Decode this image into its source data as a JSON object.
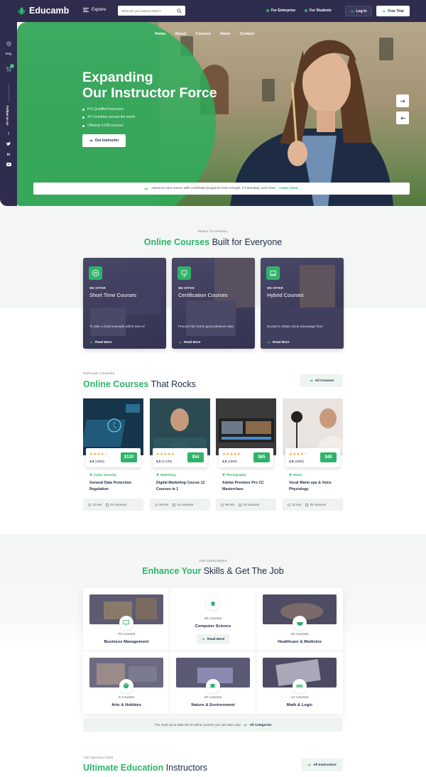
{
  "header": {
    "brand": "Educamb",
    "explore_label": "Explore",
    "search_placeholder": "What do you want to learn?",
    "for_enterprise": "For Enterprise",
    "for_students": "For Students",
    "login_label": "Log In",
    "free_trial_label": "Free Trial"
  },
  "rail": {
    "lang": "Eng",
    "cart_count": "0",
    "follow": "Follow us on"
  },
  "hero": {
    "nav": [
      "Home",
      "About",
      "Courses",
      "News",
      "Contact"
    ],
    "title_line1": "Expanding",
    "title_line2": "Our Instructor Force",
    "bullets": [
      "H.5 Qualified Instructor",
      "24 Countries around the world",
      "Offering 4,638 courses"
    ],
    "cta_label": "Our Instructor",
    "bar_text": "Advance your career with certificate programs from Google, IIT Bombay, and more.",
    "bar_link": "Learn more."
  },
  "offers": {
    "eyebrow": "Ready to Upskill",
    "title_highlight": "Online Courses",
    "title_rest": "Built for Everyone",
    "cards": [
      {
        "we": "WE OFFER",
        "title": "Short Time Courses",
        "desc": "To take a trivial example which ever of",
        "more": "Read More"
      },
      {
        "we": "WE OFFER",
        "title": "Certification Courses",
        "desc": "Procure him some great pleasure take",
        "more": "Read More"
      },
      {
        "we": "WE OFFER",
        "title": "Hybrid Courses",
        "desc": "Except to obtain some advantage from",
        "more": "Read More"
      }
    ]
  },
  "popular": {
    "eyebrow": "Popular Courses",
    "title_highlight": "Online Courses",
    "title_rest": "That Rocks",
    "all_label": "All Courses",
    "courses": [
      {
        "rating": "4.5",
        "reviews": "(1650)",
        "price": "$120",
        "category": "Cyber Security",
        "title": "General Data Protection Regulation",
        "hours": "12 Hrs",
        "lessons": "24 Lessons",
        "stars": 4.5
      },
      {
        "rating": "5.0",
        "reviews": "(2,228)",
        "price": "$54",
        "category": "Marketing",
        "title": "Digital Marketing Course 12 Courses in 1",
        "hours": "08 Hrs",
        "lessons": "14 Lessons",
        "stars": 5
      },
      {
        "rating": "4.0",
        "reviews": "(1650)",
        "price": "$65",
        "category": "Photography",
        "title": "Adobe Premiere Pro CC Masterclass",
        "hours": "06 Hrs",
        "lessons": "24 Lessons",
        "stars": 4
      },
      {
        "rating": "4.5",
        "reviews": "(1650)",
        "price": "$49",
        "category": "Music",
        "title": "Vocal Warm ups & Voice Physiology",
        "hours": "12 Hrs",
        "lessons": "20 Lessons",
        "stars": 4.5
      }
    ]
  },
  "categories": {
    "eyebrow": "Top Categories",
    "title_highlight": "Enhance Your",
    "title_rest": "Skills & Get The Job",
    "items": [
      {
        "count": "76 Courses",
        "name": "Business Management",
        "icon": "presentation-icon"
      },
      {
        "count": "45 Courses",
        "name": "Computer Science",
        "icon": "bug-icon",
        "read_more": "Read More"
      },
      {
        "count": "26 Courses",
        "name": "Healthcare & Medicine",
        "icon": "bowl-icon"
      },
      {
        "count": "6 Courses",
        "name": "Arts & Hobbies",
        "icon": "palette-icon"
      },
      {
        "count": "20 Courses",
        "name": "Nature & Environment",
        "icon": "bug-nature-icon"
      },
      {
        "count": "12 Courses",
        "name": "Math & Logic",
        "icon": "infinity-icon"
      }
    ],
    "bar_text": "The most up-to-date list of online courses you can take now",
    "bar_link": "All Categories"
  },
  "instructors": {
    "eyebrow": "Top Instructors",
    "title_highlight": "Ultimate Education",
    "title_rest": "Instructors",
    "all_label": "All Instructors"
  },
  "colors": {
    "accent": "#2fb36a",
    "navy": "#2f2d4e",
    "light": "#f3f6f4"
  }
}
